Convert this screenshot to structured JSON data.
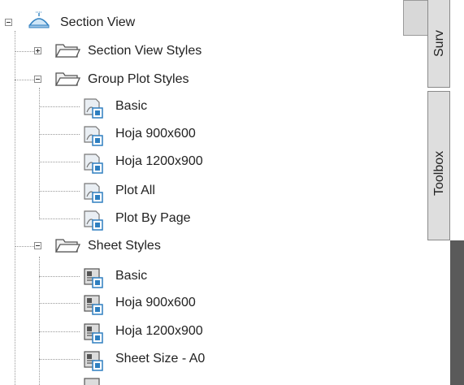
{
  "tree": {
    "root": {
      "label": "Section View",
      "icon": "section-view-icon"
    },
    "section_view_styles": {
      "label": "Section View Styles",
      "icon": "folder-icon",
      "toggle": "+"
    },
    "group_plot_styles": {
      "label": "Group Plot Styles",
      "icon": "folder-open-icon",
      "toggle": "-",
      "items": [
        "Basic",
        "Hoja 900x600",
        "Hoja 1200x900",
        "Plot All",
        "Plot By Page"
      ]
    },
    "sheet_styles": {
      "label": "Sheet Styles",
      "icon": "folder-open-icon",
      "toggle": "-",
      "items": [
        "Basic",
        "Hoja 900x600",
        "Hoja 1200x900",
        "Sheet Size - A0"
      ]
    }
  },
  "side_panel": {
    "tabs": [
      "Surv",
      "Toolbox"
    ]
  }
}
